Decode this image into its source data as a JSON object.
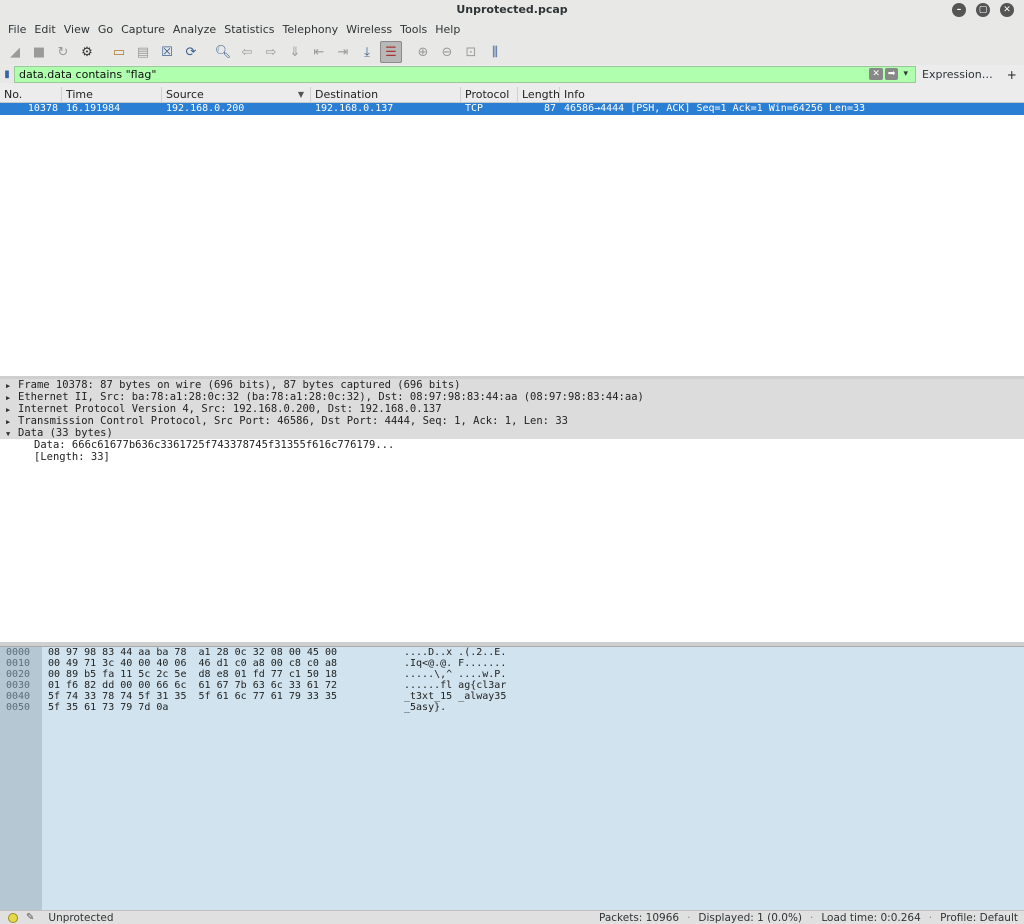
{
  "window": {
    "title": "Unprotected.pcap",
    "controls": [
      "minimize-icon",
      "restore-icon",
      "close-icon"
    ]
  },
  "menu": [
    "File",
    "Edit",
    "View",
    "Go",
    "Capture",
    "Analyze",
    "Statistics",
    "Telephony",
    "Wireless",
    "Tools",
    "Help"
  ],
  "toolbar": {
    "icons": [
      "shark-fin-start-icon",
      "stop-square-icon",
      "restart-fin-icon",
      "options-gear-icon",
      "open-folder-icon",
      "save-file-icon",
      "close-file-icon",
      "reload-icon",
      "find-magnifier-icon",
      "go-back-icon",
      "go-forward-icon",
      "go-to-packet-icon",
      "first-packet-icon",
      "last-packet-icon",
      "autoscroll-icon",
      "colorize-icon",
      "zoom-in-icon",
      "zoom-out-icon",
      "normal-size-icon",
      "resize-columns-icon"
    ]
  },
  "filter": {
    "value": "data.data contains \"flag\"",
    "expression_label": "Expression…",
    "add_label": "+"
  },
  "packet_list": {
    "columns": [
      "No.",
      "Time",
      "Source",
      "Destination",
      "Protocol",
      "Length",
      "Info"
    ],
    "sort_indicator": "▼",
    "rows": [
      {
        "no": "10378",
        "time": "16.191984",
        "source": "192.168.0.200",
        "destination": "192.168.0.137",
        "protocol": "TCP",
        "length": "87",
        "info": "46586→4444 [PSH, ACK] Seq=1 Ack=1 Win=64256 Len=33"
      }
    ]
  },
  "details": {
    "tree": [
      {
        "text": "Frame 10378: 87 bytes on wire (696 bits), 87 bytes captured (696 bits)",
        "expanded": false
      },
      {
        "text": "Ethernet II, Src: ba:78:a1:28:0c:32 (ba:78:a1:28:0c:32), Dst: 08:97:98:83:44:aa (08:97:98:83:44:aa)",
        "expanded": false
      },
      {
        "text": "Internet Protocol Version 4, Src: 192.168.0.200, Dst: 192.168.0.137",
        "expanded": false
      },
      {
        "text": "Transmission Control Protocol, Src Port: 46586, Dst Port: 4444, Seq: 1, Ack: 1, Len: 33",
        "expanded": false
      },
      {
        "text": "Data (33 bytes)",
        "expanded": true
      }
    ],
    "children": [
      "Data: 666c61677b636c3361725f743378745f31355f616c776179...",
      "[Length: 33]"
    ]
  },
  "bytes": {
    "offsets": [
      "0000",
      "0010",
      "0020",
      "0030",
      "0040",
      "0050"
    ],
    "hex": [
      "08 97 98 83 44 aa ba 78  a1 28 0c 32 08 00 45 00",
      "00 49 71 3c 40 00 40 06  46 d1 c0 a8 00 c8 c0 a8",
      "00 89 b5 fa 11 5c 2c 5e  d8 e8 01 fd 77 c1 50 18",
      "01 f6 82 dd 00 00 66 6c  61 67 7b 63 6c 33 61 72",
      "5f 74 33 78 74 5f 31 35  5f 61 6c 77 61 79 33 35",
      "5f 35 61 73 79 7d 0a"
    ],
    "ascii": [
      "....D..x .(.2..E.",
      ".Iq<@.@. F.......",
      ".....\\,^ ....w.P.",
      "......fl ag{cl3ar",
      "_t3xt_15 _alway35",
      "_5asy}."
    ]
  },
  "status": {
    "file": "Unprotected",
    "packets": "Packets: 10966",
    "displayed": "Displayed: 1 (0.0%)",
    "load_time": "Load time: 0:0.264",
    "profile": "Profile: Default"
  }
}
